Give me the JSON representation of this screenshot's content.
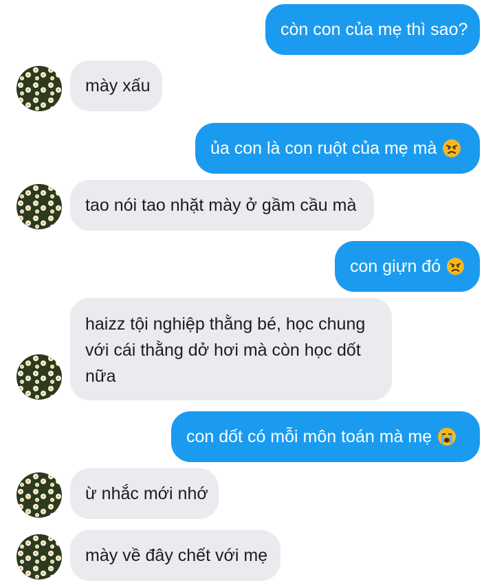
{
  "conversation": {
    "messages": [
      {
        "side": "out",
        "text": "còn con của mẹ thì sao?",
        "emoji": ""
      },
      {
        "side": "in",
        "text": "mày xấu",
        "emoji": ""
      },
      {
        "side": "out",
        "text": "ủa con là con ruột của mẹ mà",
        "emoji": "angry-face"
      },
      {
        "side": "in",
        "text": "tao nói tao nhặt mày ở gầm cầu mà",
        "emoji": ""
      },
      {
        "side": "out",
        "text": "con giựn đó",
        "emoji": "angry-face"
      },
      {
        "side": "in",
        "text": "haizz tội nghiệp thằng bé, học chung với cái thằng dở hơi mà còn học dốt nữa",
        "emoji": ""
      },
      {
        "side": "out",
        "text": "con dốt có mỗi môn toán mà mẹ",
        "emoji": "crying-face"
      },
      {
        "side": "in",
        "text": "ừ nhắc mới nhớ",
        "emoji": ""
      },
      {
        "side": "in",
        "text": "mày về đây chết với mẹ",
        "emoji": ""
      }
    ]
  },
  "colors": {
    "outgoing_bubble": "#1a9bef",
    "incoming_bubble": "#e9ebef",
    "avatar_theme": "daisies"
  }
}
